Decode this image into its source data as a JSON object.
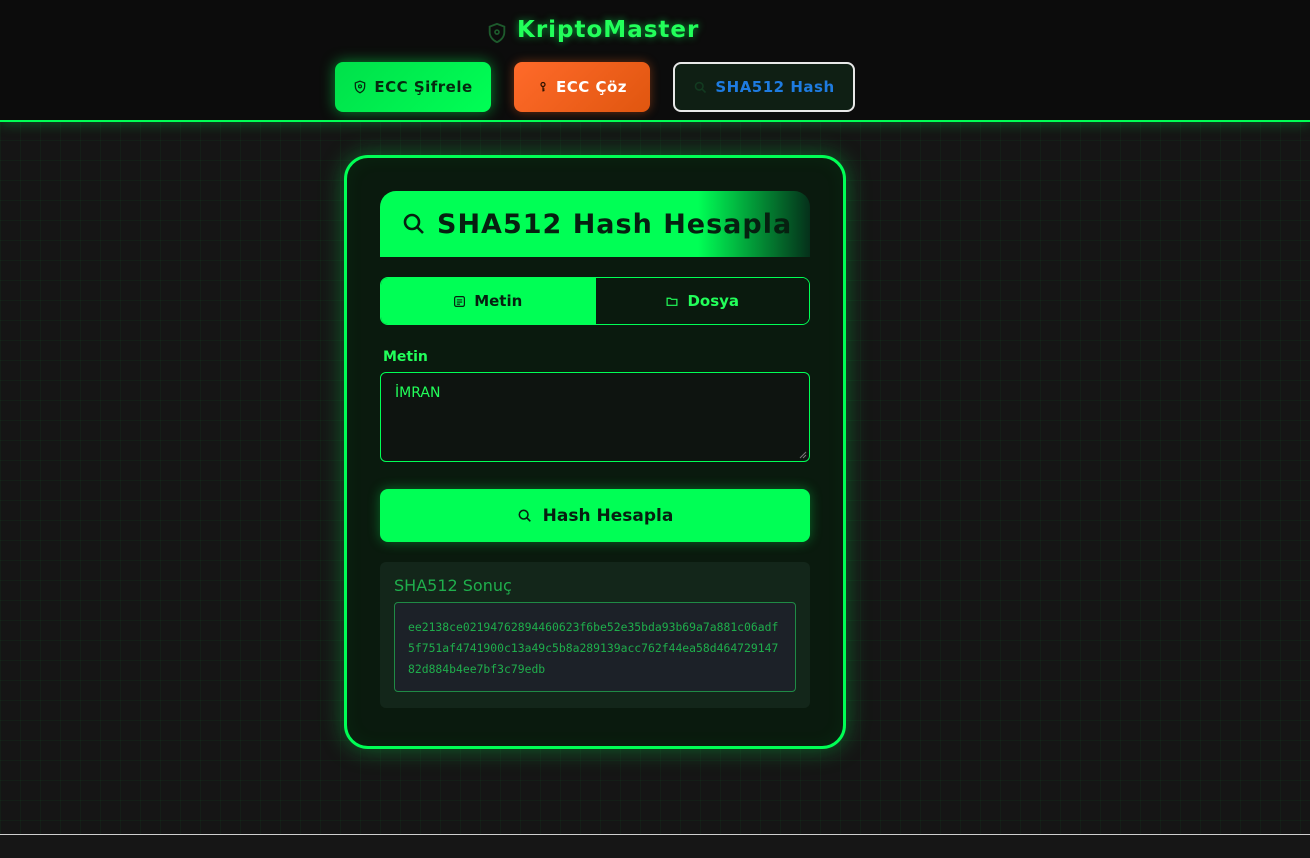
{
  "app": {
    "title": "KriptoMaster",
    "brand_icon": "shield-icon"
  },
  "nav": {
    "encrypt_label": "ECC Şifrele",
    "decrypt_label": "ECC Çöz",
    "hash_label": "SHA512 Hash",
    "active": "hash"
  },
  "card": {
    "title": "SHA512 Hash Hesapla",
    "mode_text_label": "Metin",
    "mode_file_label": "Dosya",
    "active_mode": "text",
    "field_label": "Metin",
    "input_value": "İMRAN",
    "submit_label": "Hash Hesapla"
  },
  "result": {
    "title": "SHA512 Sonuç",
    "value": "ee2138ce02194762894460623f6be52e35bda93b69a7a881c06adf5f751af4741900c13a49c5b8a289139acc762f44ea58d46472914782d884b4ee7bf3c79edb"
  },
  "colors": {
    "accent": "#00ff55",
    "decrypt": "#ff6a2a",
    "hash_nav_text": "#1e7be0",
    "card_bg": "#0a1a0e"
  }
}
